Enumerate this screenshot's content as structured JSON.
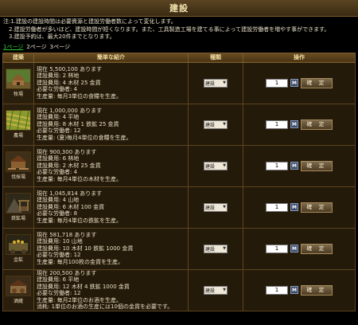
{
  "title": "建設",
  "notes": [
    "注:1.建設の建設時間は必要資源と建設労働者数によって変化します。",
    "　2.建設労働者が多いほど、建設時間が短くなります。また、工具製造工場を建てる事によって建設労働者を増やす事ができます。",
    "　3.建設予約は、最大20件までとなります。"
  ],
  "pager": [
    "1ページ",
    "2ページ",
    "3ページ"
  ],
  "headers": {
    "building": "建築",
    "desc": "簡単な紹介",
    "type": "種類",
    "op": "操作"
  },
  "type_default": "建設",
  "qty_default": "1",
  "max_label": "M",
  "confirm_label": "確 定",
  "buildings": [
    {
      "name": "牧場",
      "lines": [
        "現在 5,500,100 あります",
        "建設費用: 2 林地",
        "建設費用: 4 木材 25 金貨",
        "必要な労働者: 4",
        "生産量: 毎月3単位の食糧を生産。"
      ]
    },
    {
      "name": "農場",
      "lines": [
        "現在 1,000,000 あります",
        "建設費用: 4 平地",
        "建設費用: 8 木材 1 鉄鉱 25 金貨",
        "必要な労働者: 12",
        "生産量: (夏)毎月4単位の食糧を生産。"
      ]
    },
    {
      "name": "伐採場",
      "lines": [
        "現在 900,300 あります",
        "建設費用: 6 林地",
        "建設費用: 2 木材 25 金貨",
        "必要な労働者: 4",
        "生産量: 毎月4単位の木材を生産。"
      ]
    },
    {
      "name": "鉄鉱場",
      "lines": [
        "現在 1,045,814 あります",
        "建設費用: 4 山地",
        "建設費用: 6 木材 100 金貨",
        "必要な労働者: 8",
        "生産量: 毎月4単位の鉄鉱を生産。"
      ]
    },
    {
      "name": "金鉱",
      "lines": [
        "現在 581,718 あります",
        "建設費用: 10 山地",
        "建設費用: 10 木材 10 鉄鉱 1000 金貨",
        "必要な労働者: 12",
        "生産量: 毎月100枚の金貨を生産。"
      ]
    },
    {
      "name": "酒蔵",
      "lines": [
        "現在 200,500 あります",
        "建設費用: 6 平地",
        "建設費用: 12 木材 4 鉄鉱 1000 金貨",
        "必要な労働者: 12",
        "生産量: 毎月2単位のお酒を生産。",
        "消耗: 1単位のお酒の生産には10個の金貨を必要です。"
      ]
    }
  ]
}
